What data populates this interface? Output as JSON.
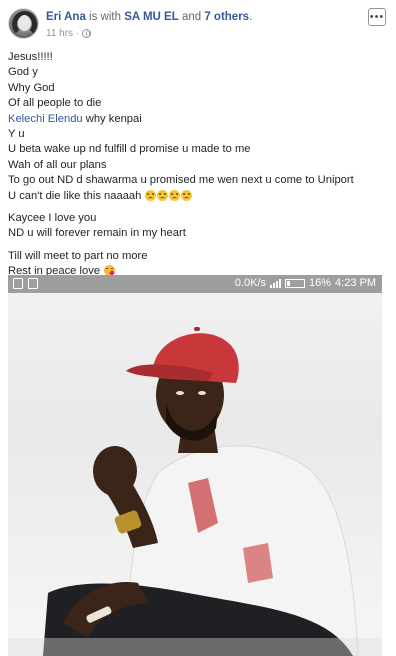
{
  "post": {
    "author": "Eri Ana",
    "with_text": "is with",
    "tagged": "SA MU EL",
    "and_text": "and",
    "others": "7 others",
    "period": ".",
    "time": "11 hrs",
    "separator": "·",
    "privacy_icon": "globe-icon",
    "more_icon": "more-options-icon",
    "more_label": "•••"
  },
  "message": {
    "l1": "Jesus!!!!!",
    "l2": "God y",
    "l3": "Why God",
    "l4": "Of all people to die",
    "l5_mention": "Kelechi Elendu",
    "l5_rest": " why kenpai",
    "l6": "Y u",
    "l7": "U beta wake up nd fulfill d promise u made to me",
    "l8": "Wah of all our plans",
    "l9": "To go out ND d shawarma u promised me wen next u come to Uniport",
    "l10": "U can't die like this naaaah",
    "l11": "Kaycee I love you",
    "l12": "ND u will forever remain in my heart",
    "l13": "Till will meet to part no more",
    "l14": "Rest in peace love",
    "sad_emoji": "sad-face-emoji",
    "kiss_emoji": "kissing-face-emoji"
  },
  "photo": {
    "speed": "0.0K/s",
    "battery": "16%",
    "clock": "4:23 PM",
    "subject": "man-in-red-cap-photo",
    "colors": {
      "cap": "#c8383a",
      "shirt": "#f4f4f4",
      "skin": "#3b2418",
      "status_bar": "#9e9e9e"
    }
  }
}
